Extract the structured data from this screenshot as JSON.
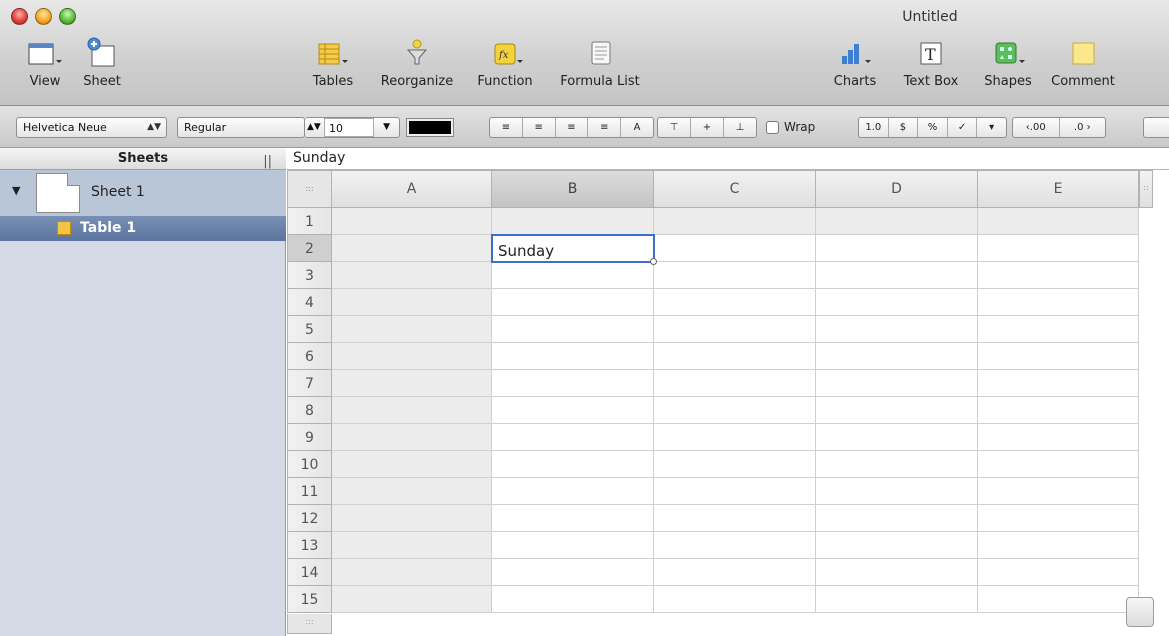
{
  "window": {
    "title": "Untitled"
  },
  "toolbar": {
    "view": "View",
    "sheet": "Sheet",
    "tables": "Tables",
    "reorganize": "Reorganize",
    "function": "Function",
    "formula_list": "Formula List",
    "charts": "Charts",
    "text_box": "Text Box",
    "shapes": "Shapes",
    "comment": "Comment"
  },
  "formatbar": {
    "font_family": "Helvetica Neue",
    "font_style": "Regular",
    "font_size": "10",
    "wrap_label": "Wrap",
    "number_format": [
      "1.0",
      "$",
      "%",
      "✓",
      "▾"
    ],
    "decimals": [
      "‹.00",
      ".0 ›"
    ]
  },
  "sidebar": {
    "header": "Sheets",
    "sheets": [
      {
        "label": "Sheet 1",
        "tables": [
          {
            "label": "Table 1"
          }
        ]
      }
    ]
  },
  "formula_bar": {
    "value": "Sunday"
  },
  "grid": {
    "columns": [
      "A",
      "B",
      "C",
      "D",
      "E"
    ],
    "rows": [
      "1",
      "2",
      "3",
      "4",
      "5",
      "6",
      "7",
      "8",
      "9",
      "10",
      "11",
      "12",
      "13",
      "14",
      "15"
    ],
    "selected_cell": "B2",
    "cells": {
      "B2": "Sunday"
    }
  }
}
